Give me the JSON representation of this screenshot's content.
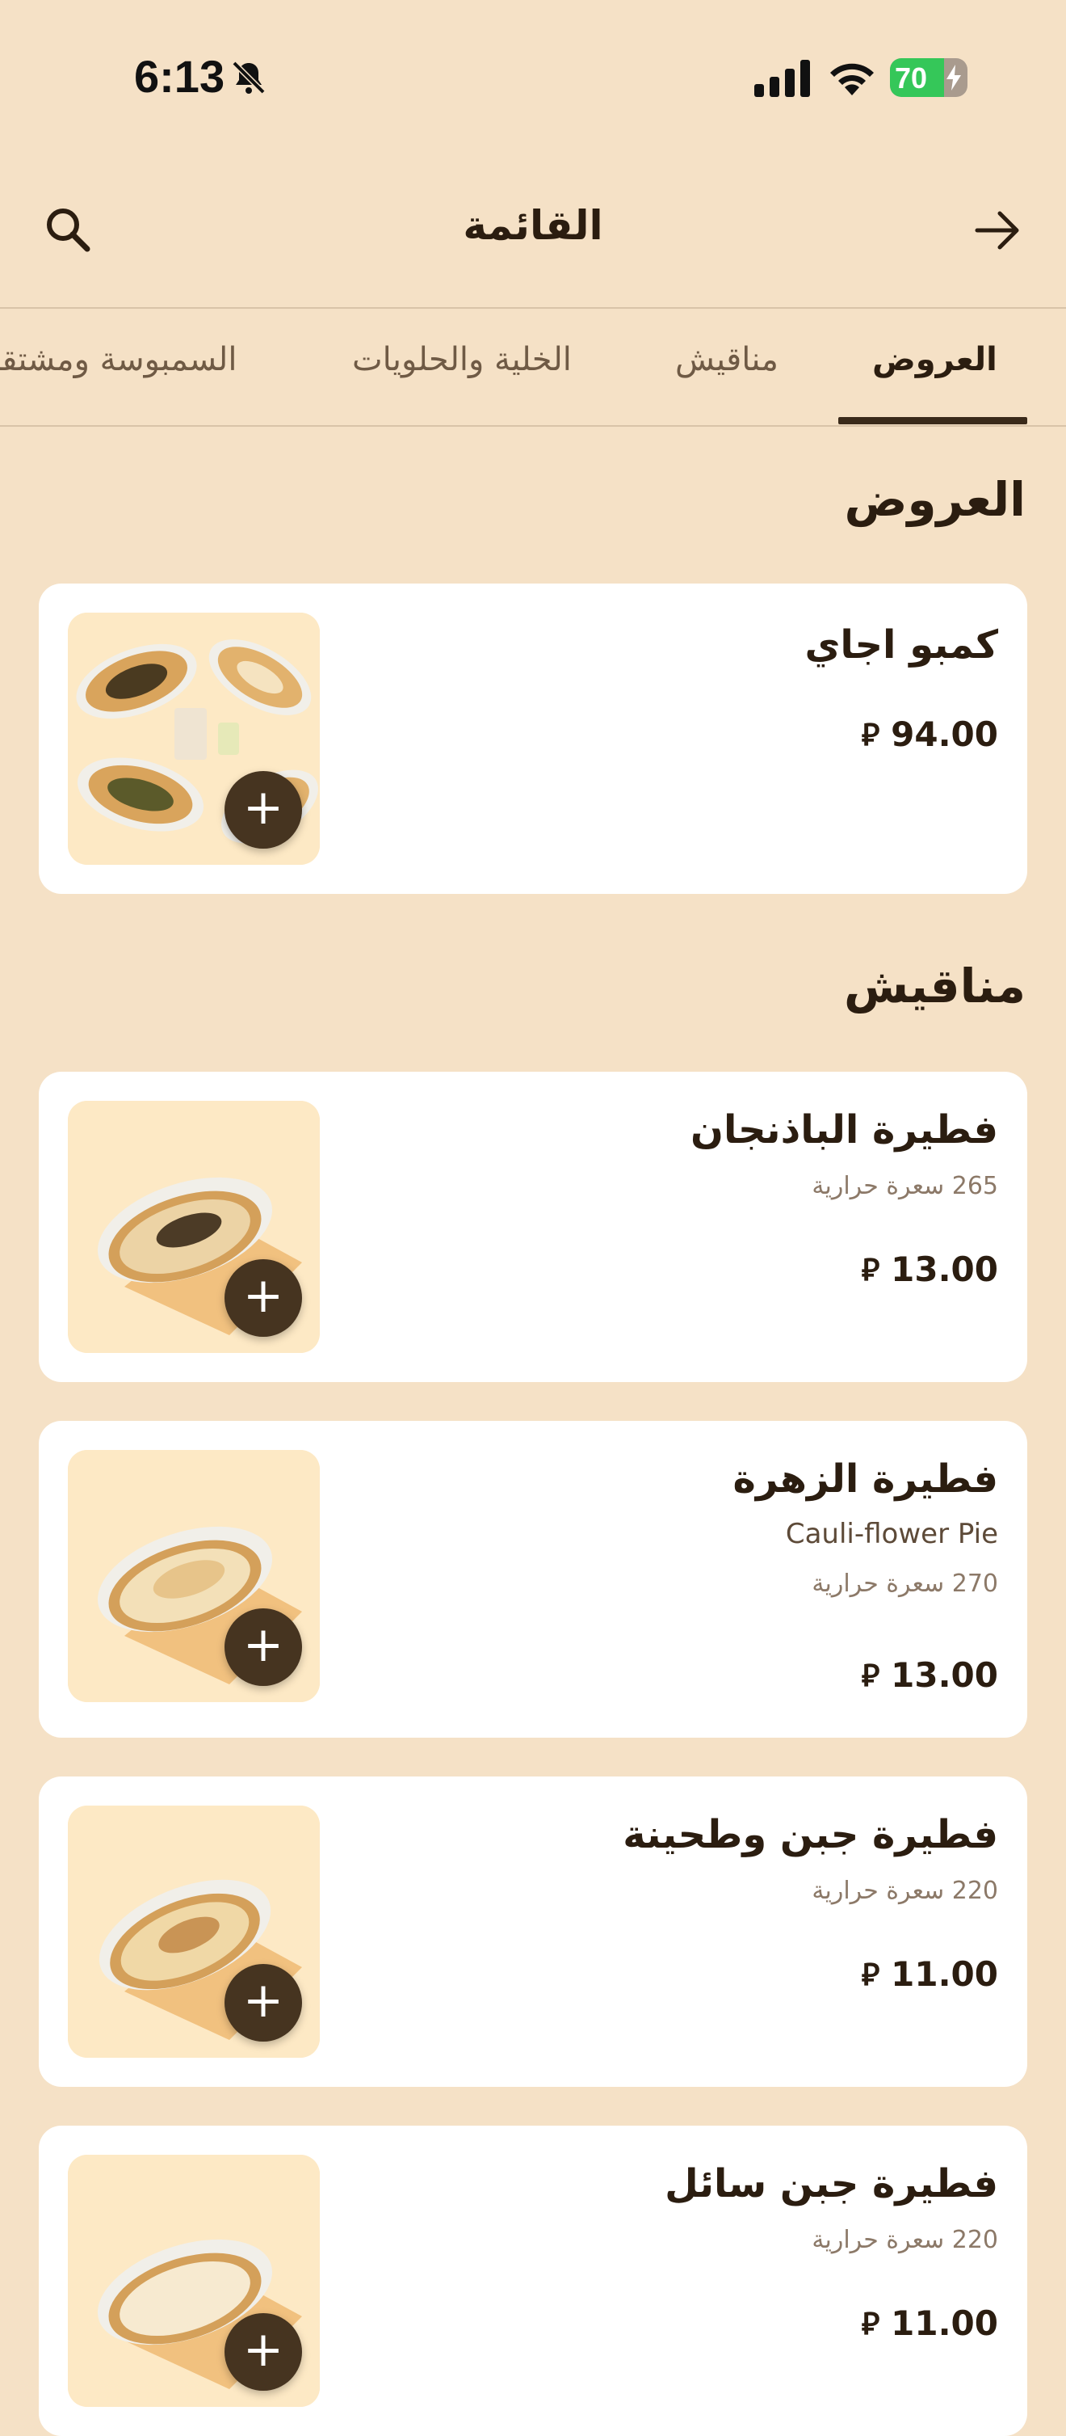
{
  "status_bar": {
    "time": "6:13",
    "battery": "70",
    "battery_level": 0.7,
    "icons": [
      "bell-slash-icon",
      "cellular-signal-icon",
      "wifi-icon",
      "battery-charging-icon"
    ]
  },
  "header": {
    "title": "القائمة",
    "search_icon": "search-icon",
    "back_icon": "arrow-right-icon"
  },
  "tabs": [
    {
      "label": "العروض",
      "active": true
    },
    {
      "label": "مناقيش",
      "active": false
    },
    {
      "label": "الخلية والحلويات",
      "active": false
    },
    {
      "label": "السمبوسة ومشتقا",
      "active": false
    }
  ],
  "sections": [
    {
      "title": "العروض",
      "items": [
        {
          "name": "كمبو اجاي",
          "price": "94.00",
          "currency": "⃁"
        }
      ]
    },
    {
      "title": "مناقيش",
      "items": [
        {
          "name": "فطيرة الباذنجان",
          "calories": "265 سعرة حرارية",
          "price": "13.00",
          "currency": "⃁"
        },
        {
          "name": "فطيرة الزهرة",
          "subtitle": "Cauli-flower Pie",
          "calories": "270 سعرة حرارية",
          "price": "13.00",
          "currency": "⃁"
        },
        {
          "name": "فطيرة جبن وطحينة",
          "calories": "220 سعرة حرارية",
          "price": "11.00",
          "currency": "⃁"
        },
        {
          "name": "فطيرة جبن سائل",
          "calories": "220 سعرة حرارية",
          "price": "11.00",
          "currency": "⃁"
        }
      ]
    }
  ],
  "add_label": "+",
  "colors": {
    "background": "#f5e1c6",
    "card": "#ffffff",
    "accent": "#463420",
    "text": "#2b1d10"
  }
}
